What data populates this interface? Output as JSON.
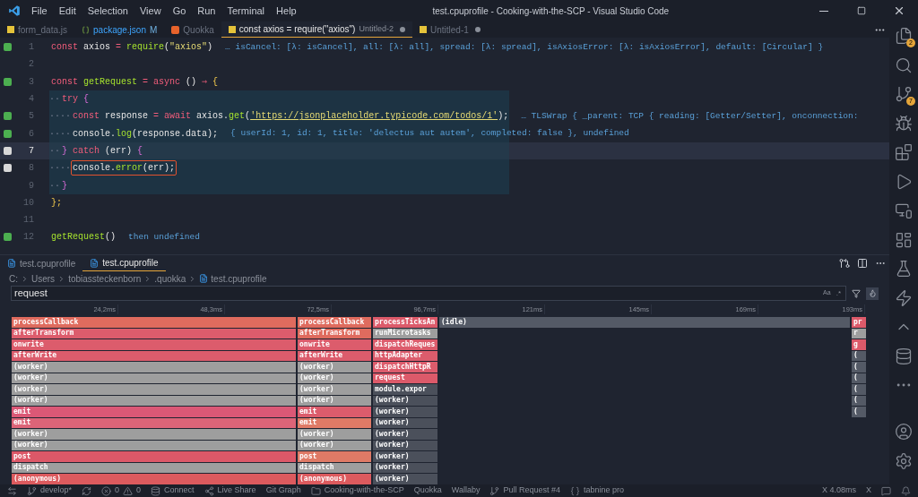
{
  "menu": [
    "File",
    "Edit",
    "Selection",
    "View",
    "Go",
    "Run",
    "Terminal",
    "Help"
  ],
  "window": {
    "title": "test.cpuprofile - Cooking-with-the-SCP - Visual Studio Code"
  },
  "tabs": [
    {
      "label": "form_data.js",
      "kind": "js",
      "selected": false,
      "dim": true,
      "dirty": false
    },
    {
      "label": "package.json",
      "kind": "json",
      "suffix": "M",
      "selected": false,
      "dim": false,
      "dirty": false
    },
    {
      "label": "Quokka",
      "kind": "quokka",
      "selected": false,
      "dim": true,
      "dirty": false
    },
    {
      "label": "const axios = require(\"axios\")",
      "kind": "js",
      "detail": "Untitled-2",
      "dirty": true,
      "selected": true,
      "dim": false
    },
    {
      "label": "Untitled-1",
      "kind": "js",
      "dirty": true,
      "selected": false,
      "dim": true
    }
  ],
  "editor": {
    "lines": [
      {
        "number": "1",
        "gutter": {
          "kind": "covered"
        },
        "current": false,
        "scope": false,
        "tokens": [
          {
            "text": "const ",
            "kind": "keyword"
          },
          {
            "text": "axios ",
            "kind": "ident"
          },
          {
            "text": "= ",
            "kind": "operator"
          },
          {
            "text": "require",
            "kind": "func"
          },
          {
            "text": "(",
            "kind": "punct"
          },
          {
            "text": "\"axios\"",
            "kind": "string"
          },
          {
            "text": ")",
            "kind": "punct"
          }
        ],
        "hint": "… isCancel: [λ: isCancel], all: [λ: all], spread: [λ: spread], isAxiosError: [λ: isAxiosError], default: [Circular] }"
      },
      {
        "number": "2",
        "current": false,
        "scope": false
      },
      {
        "number": "3",
        "gutter": {
          "kind": "covered"
        },
        "current": false,
        "scope": false,
        "tokens": [
          {
            "text": "const ",
            "kind": "keyword"
          },
          {
            "text": "getRequest ",
            "kind": "func"
          },
          {
            "text": "= ",
            "kind": "operator"
          },
          {
            "text": "async ",
            "kind": "keyword"
          },
          {
            "text": "() ",
            "kind": "punct"
          },
          {
            "text": "⇒ ",
            "kind": "keyword"
          },
          {
            "text": "{",
            "kind": "brace"
          }
        ]
      },
      {
        "number": "4",
        "current": false,
        "scope": true,
        "tokens": [
          {
            "text": "··",
            "kind": "whitespace"
          },
          {
            "text": "try ",
            "kind": "keyword"
          },
          {
            "text": "{",
            "kind": "brace2"
          }
        ]
      },
      {
        "number": "5",
        "gutter": {
          "kind": "covered"
        },
        "current": false,
        "scope": true,
        "tokens": [
          {
            "text": "····",
            "kind": "whitespace"
          },
          {
            "text": "const ",
            "kind": "keyword"
          },
          {
            "text": "response ",
            "kind": "ident"
          },
          {
            "text": "= ",
            "kind": "operator"
          },
          {
            "text": "await ",
            "kind": "keyword"
          },
          {
            "text": "axios.",
            "kind": "ident"
          },
          {
            "text": "get",
            "kind": "func"
          },
          {
            "text": "(",
            "kind": "punct"
          },
          {
            "text": "'https://jsonplaceholder.typicode.com/todos/1'",
            "kind": "url"
          },
          {
            "text": ");",
            "kind": "punct"
          }
        ],
        "hint": "… TLSWrap { _parent: TCP { reading: [Getter/Setter], onconnection:"
      },
      {
        "number": "6",
        "gutter": {
          "kind": "covered"
        },
        "current": false,
        "scope": true,
        "tokens": [
          {
            "text": "····",
            "kind": "whitespace"
          },
          {
            "text": "console.",
            "kind": "ident"
          },
          {
            "text": "log",
            "kind": "func"
          },
          {
            "text": "(response.data);",
            "kind": "ident"
          }
        ],
        "hint": "{ userId: 1, id: 1, title: 'delectus aut autem', completed: false }, undefined"
      },
      {
        "number": "7",
        "gutter": {
          "kind": "uncovered"
        },
        "current": true,
        "scope": true,
        "tokens": [
          {
            "text": "··",
            "kind": "whitespace"
          },
          {
            "text": "} ",
            "kind": "brace2"
          },
          {
            "text": "catch ",
            "kind": "keyword"
          },
          {
            "text": "(err) ",
            "kind": "ident"
          },
          {
            "text": "{",
            "kind": "brace2"
          }
        ]
      },
      {
        "number": "8",
        "gutter": {
          "kind": "uncovered"
        },
        "current": false,
        "scope": true,
        "outlined": true,
        "tokens": [
          {
            "text": "····",
            "kind": "whitespace"
          },
          {
            "text": "console.",
            "kind": "ident"
          },
          {
            "text": "error",
            "kind": "func"
          },
          {
            "text": "(err);",
            "kind": "ident"
          }
        ]
      },
      {
        "number": "9",
        "current": false,
        "scope": true,
        "tokens": [
          {
            "text": "··",
            "kind": "whitespace"
          },
          {
            "text": "}",
            "kind": "brace2"
          }
        ]
      },
      {
        "number": "10",
        "current": false,
        "scope": false,
        "tokens": [
          {
            "text": "};",
            "kind": "brace"
          }
        ]
      },
      {
        "number": "11",
        "current": false,
        "scope": false
      },
      {
        "number": "12",
        "gutter": {
          "kind": "covered"
        },
        "current": false,
        "scope": false,
        "tokens": [
          {
            "text": "getRequest",
            "kind": "func"
          },
          {
            "text": "()",
            "kind": "punct"
          }
        ],
        "hint": "then undefined"
      }
    ]
  },
  "panel": {
    "tabs": [
      {
        "label": "test.cpuprofile",
        "selected": false
      },
      {
        "label": "test.cpuprofile",
        "selected": true
      }
    ],
    "breadcrumbs": [
      "C:",
      "Users",
      "tobiassteckenborn",
      ".quokka",
      "test.cpuprofile"
    ],
    "search": {
      "value": "request",
      "case_label": "Aa",
      "regex_label": ".*"
    },
    "ruler": [
      "24,2ms",
      "48,3ms",
      "72,5ms",
      "96,7ms",
      "121ms",
      "145ms",
      "169ms",
      "193ms"
    ],
    "flame_columns": [
      {
        "frames": [
          {
            "label": "processCallback",
            "color": "#df6b5e"
          },
          {
            "label": "afterTransform",
            "color": "#dc5c6c"
          },
          {
            "label": "onwrite",
            "color": "#dc5c6c"
          },
          {
            "label": "afterWrite",
            "color": "#dc5c6c"
          },
          {
            "label": "(worker)",
            "color": "#9e9e9e"
          },
          {
            "label": "(worker)",
            "color": "#9e9e9e"
          },
          {
            "label": "(worker)",
            "color": "#9e9e9e"
          },
          {
            "label": "(worker)",
            "color": "#9e9e9e"
          },
          {
            "label": "emit",
            "color": "#db5876"
          },
          {
            "label": "emit",
            "color": "#dc6478"
          },
          {
            "label": "(worker)",
            "color": "#9e9e9e"
          },
          {
            "label": "(worker)",
            "color": "#9e9e9e"
          },
          {
            "label": "post",
            "color": "#dc5868"
          },
          {
            "label": "dispatch",
            "color": "#9e9e9e"
          },
          {
            "label": "(anonymous)",
            "color": "#dc5a5e"
          }
        ]
      },
      {
        "frames": [
          {
            "label": "processCallback",
            "color": "#df6b5e"
          },
          {
            "label": "afterTransform",
            "color": "#df6b5e"
          },
          {
            "label": "onwrite",
            "color": "#dc5c6c"
          },
          {
            "label": "afterWrite",
            "color": "#dc5c6c"
          },
          {
            "label": "(worker)",
            "color": "#9e9e9e"
          },
          {
            "label": "(worker)",
            "color": "#9e9e9e"
          },
          {
            "label": "(worker)",
            "color": "#9e9e9e"
          },
          {
            "label": "(worker)",
            "color": "#9e9e9e"
          },
          {
            "label": "emit",
            "color": "#dc5c6c"
          },
          {
            "label": "emit",
            "color": "#df7a66"
          },
          {
            "label": "(worker)",
            "color": "#9e9e9e"
          },
          {
            "label": "(worker)",
            "color": "#9e9e9e"
          },
          {
            "label": "post",
            "color": "#df7a66"
          },
          {
            "label": "dispatch",
            "color": "#9e9e9e"
          },
          {
            "label": "(anonymous)",
            "color": "#dc5a5e"
          }
        ]
      },
      {
        "frames": [
          {
            "label": "processTicksAn",
            "color": "#dc5a6a"
          },
          {
            "label": "runMicrotasks",
            "color": "#9e9e9e"
          },
          {
            "label": "dispatchReques",
            "color": "#dc5c6c"
          },
          {
            "label": "httpAdapter",
            "color": "#dc5c6c"
          },
          {
            "label": "dispatchHttpR",
            "color": "#dc5c6c"
          },
          {
            "label": "request",
            "color": "#dc5a6a"
          },
          {
            "label": "module.expor",
            "color": "#4b505b"
          },
          {
            "label": "(worker)",
            "color": "#4b505b"
          },
          {
            "label": "(worker)",
            "color": "#4b505b"
          },
          {
            "label": "(worker)",
            "color": "#4b505b"
          },
          {
            "label": "(worker)",
            "color": "#4b505b"
          },
          {
            "label": "(worker)",
            "color": "#4b505b"
          },
          {
            "label": "(worker)",
            "color": "#4b505b"
          },
          {
            "label": "(worker)",
            "color": "#4b505b"
          },
          {
            "label": "(worker)",
            "color": "#4b505b"
          }
        ]
      },
      {
        "frames": [
          {
            "label": "(idle)",
            "color": "#545a66"
          }
        ]
      },
      {
        "frames": [
          {
            "label": "pr",
            "color": "#dc5a6a"
          },
          {
            "label": "r",
            "color": "#9e9e9e"
          },
          {
            "label": "g",
            "color": "#dc5a6a"
          },
          {
            "label": "(",
            "color": "#545a66"
          },
          {
            "label": "(",
            "color": "#545a66"
          },
          {
            "label": "(",
            "color": "#545a66"
          },
          {
            "label": "(",
            "color": "#545a66"
          },
          {
            "label": "(",
            "color": "#545a66"
          },
          {
            "label": "(",
            "color": "#545a66"
          }
        ]
      }
    ]
  },
  "activity_bar": [
    {
      "kind": "files",
      "badge": "2"
    },
    {
      "kind": "search"
    },
    {
      "kind": "git",
      "badge": "7"
    },
    {
      "kind": "debug"
    },
    {
      "kind": "extensions"
    },
    {
      "kind": "run"
    },
    {
      "kind": "remote"
    },
    {
      "kind": "board"
    },
    {
      "kind": "flask"
    },
    {
      "kind": "bolt"
    },
    {
      "kind": "up"
    },
    {
      "kind": "database"
    },
    {
      "kind": "more"
    },
    {
      "kind": "spacer"
    },
    {
      "kind": "account"
    },
    {
      "kind": "settings"
    }
  ],
  "status_bar": {
    "left": [
      {
        "kind": "remote"
      },
      {
        "kind": "branch",
        "text": "develop*"
      },
      {
        "kind": "sync"
      },
      {
        "kind": "problems",
        "errors": "0",
        "warnings": "0"
      },
      {
        "kind": "db",
        "text": "Connect"
      },
      {
        "kind": "share",
        "text": "Live Share"
      },
      {
        "kind": "plain",
        "text": "Git Graph"
      },
      {
        "kind": "folder",
        "text": "Cooking-with-the-SCP"
      },
      {
        "kind": "plain",
        "text": "Quokka"
      },
      {
        "kind": "plain",
        "text": "Wallaby"
      },
      {
        "kind": "branch",
        "text": "Pull Request #4"
      },
      {
        "kind": "tabnine",
        "text": "tabnine pro"
      }
    ],
    "right": [
      {
        "kind": "plain",
        "text": "X 4.08ms"
      },
      {
        "kind": "plain",
        "text": "X"
      },
      {
        "kind": "feedback"
      },
      {
        "kind": "bell"
      }
    ]
  }
}
